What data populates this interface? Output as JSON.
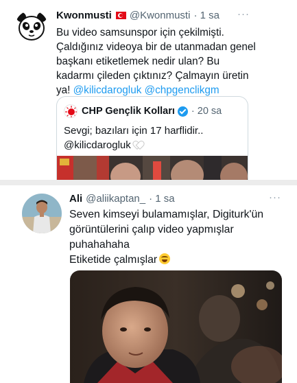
{
  "tweet1": {
    "author_name": "Kwonmusti",
    "handle": "@Kwonmusti",
    "time": "· 1 sa",
    "more": "···",
    "text_lines": [
      "Bu video samsunspor için çekilmişti.",
      "Çaldığınız videoya bir de utanmadan genel",
      "başkanı etiketlemek nedir ulan? Bu",
      "kadarmı çileden çıktınız? Çalmayın üretin"
    ],
    "last_line_prefix": "ya! ",
    "mention1": "@kilicdarogluk",
    "mention2": "@chpgenclikgm",
    "quote": {
      "author_name": "CHP Gençlik Kolları",
      "time": "· 20 sa",
      "line1": "Sevgi; bazıları için 17 harflidir..",
      "line2": "@kilicdarogluk"
    }
  },
  "tweet2": {
    "author_name": "Ali",
    "handle": "@aliikaptan_",
    "time": "· 1 sa",
    "more": "···",
    "text_lines": [
      "Seven kimseyi bulamamışlar, Digiturk'ün",
      "görüntülerini çalıp video yapmışlar",
      "puhahahaha",
      "Etiketide çalmışlar"
    ]
  },
  "colors": {
    "link": "#1d9bf0",
    "secondary_text": "#536471",
    "border": "#cfd9de"
  },
  "icons": [
    "panda-avatar",
    "turkey-flag-icon",
    "more-icon",
    "chp-logo-icon",
    "verified-badge-icon",
    "white-heart-icon",
    "laughing-emoji-icon"
  ]
}
